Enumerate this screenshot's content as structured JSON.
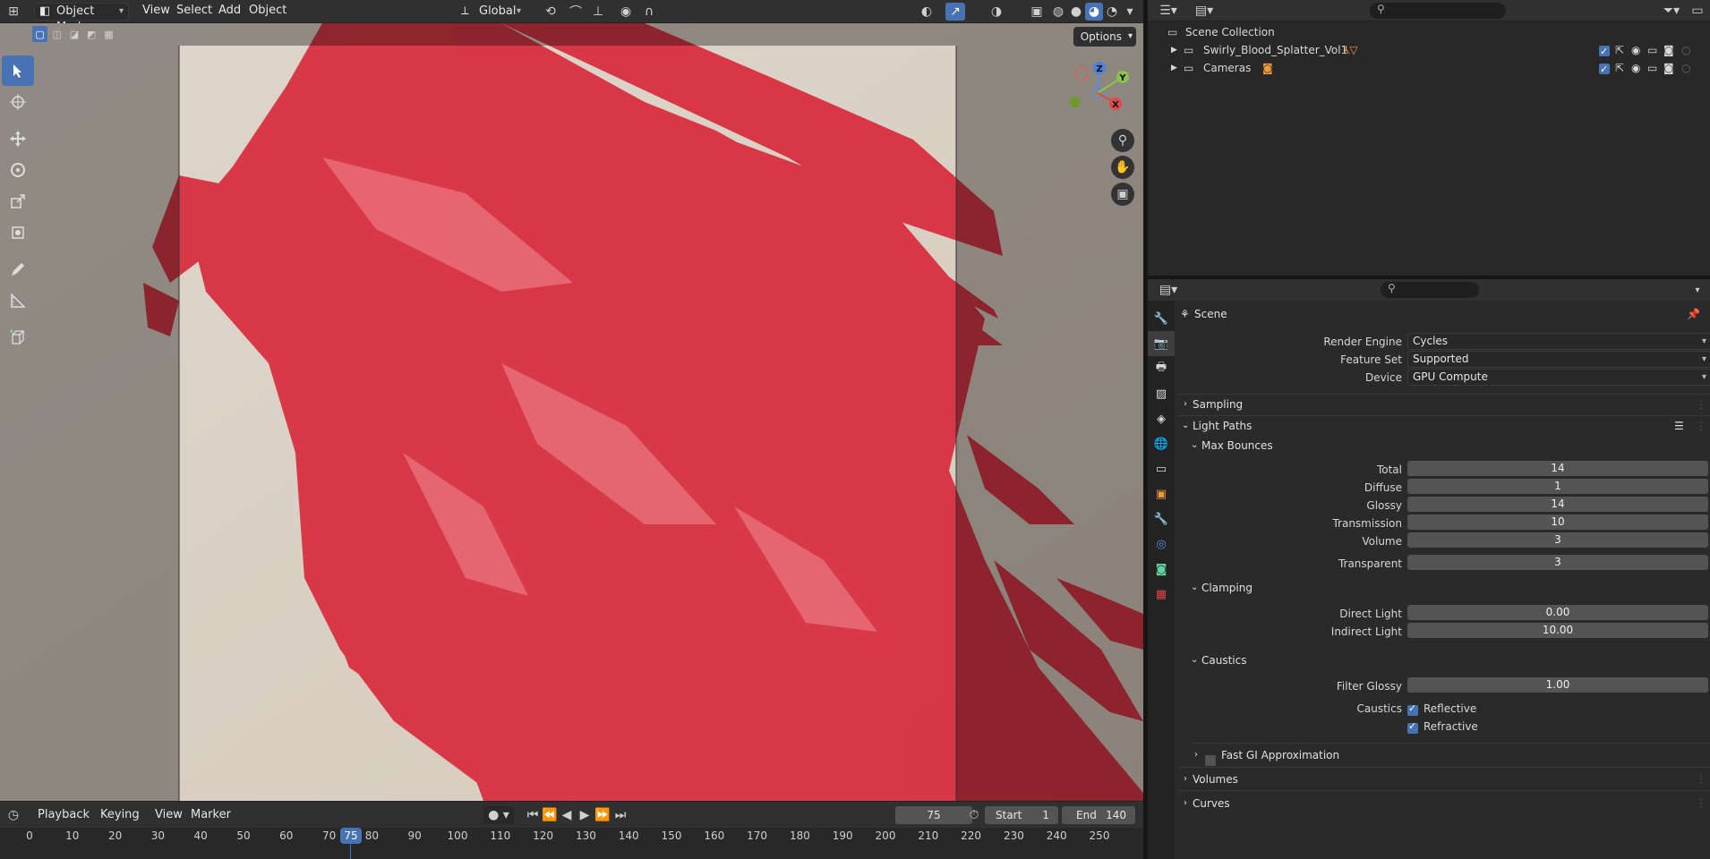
{
  "header": {
    "mode": "Object Mode",
    "menus": [
      "View",
      "Select",
      "Add",
      "Object"
    ],
    "orientation": "Global"
  },
  "viewport": {
    "options_label": "Options",
    "gizmo_axes": [
      "Z",
      "Y",
      "X"
    ]
  },
  "timeline": {
    "menus": [
      "Playback",
      "Keying",
      "View",
      "Marker"
    ],
    "current_frame": "75",
    "start_label": "Start",
    "start": "1",
    "end_label": "End",
    "end": "140",
    "ticks": [
      "0",
      "10",
      "20",
      "30",
      "40",
      "50",
      "60",
      "70",
      "75",
      "80",
      "90",
      "100",
      "110",
      "120",
      "130",
      "140",
      "150",
      "160",
      "170",
      "180",
      "190",
      "200",
      "210",
      "220",
      "230",
      "240",
      "250"
    ]
  },
  "outliner": {
    "root": "Scene Collection",
    "items": [
      {
        "name": "Swirly_Blood_Splatter_Vol1"
      },
      {
        "name": "Cameras"
      }
    ]
  },
  "properties": {
    "context": "Scene",
    "render_engine_label": "Render Engine",
    "render_engine": "Cycles",
    "feature_set_label": "Feature Set",
    "feature_set": "Supported",
    "device_label": "Device",
    "device": "GPU Compute",
    "sampling": "Sampling",
    "light_paths": "Light Paths",
    "max_bounces": {
      "title": "Max Bounces",
      "rows": [
        {
          "label": "Total",
          "value": "14"
        },
        {
          "label": "Diffuse",
          "value": "1"
        },
        {
          "label": "Glossy",
          "value": "14"
        },
        {
          "label": "Transmission",
          "value": "10"
        },
        {
          "label": "Volume",
          "value": "3"
        },
        {
          "label": "Transparent",
          "value": "3"
        }
      ]
    },
    "clamping": {
      "title": "Clamping",
      "rows": [
        {
          "label": "Direct Light",
          "value": "0.00"
        },
        {
          "label": "Indirect Light",
          "value": "10.00"
        }
      ]
    },
    "caustics": {
      "title": "Caustics",
      "filter_glossy_label": "Filter Glossy",
      "filter_glossy": "1.00",
      "caustics_label": "Caustics",
      "reflective": "Reflective",
      "refractive": "Refractive"
    },
    "fast_gi": "Fast GI Approximation",
    "volumes": "Volumes",
    "curves": "Curves"
  },
  "colors": {
    "accent": "#4772b3",
    "blood": "#d8303f",
    "backdrop": "#d4c9be"
  }
}
